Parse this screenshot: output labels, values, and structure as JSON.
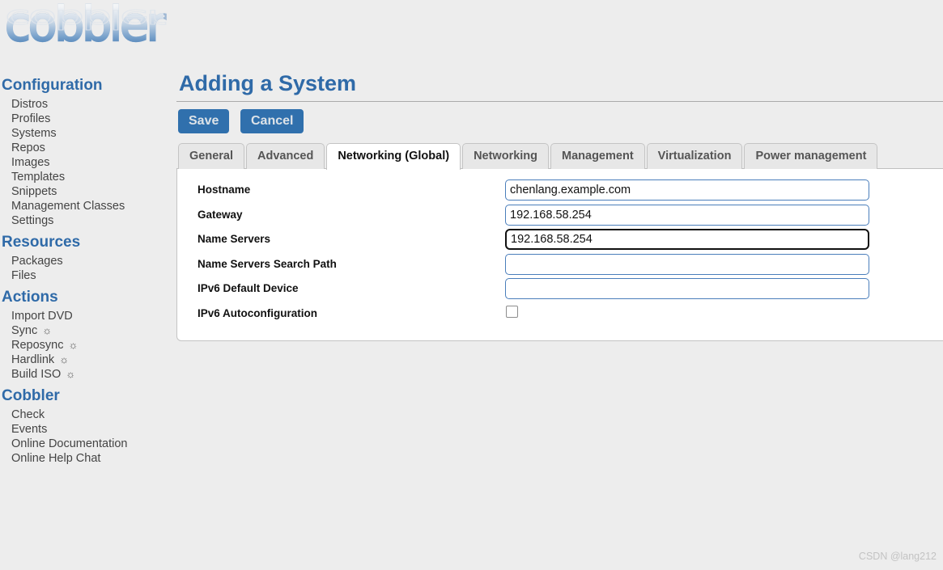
{
  "brand": {
    "logo_text": "cobbler"
  },
  "sidebar": {
    "groups": [
      {
        "heading": "Configuration",
        "items": [
          {
            "label": "Distros",
            "icon": ""
          },
          {
            "label": "Profiles",
            "icon": ""
          },
          {
            "label": "Systems",
            "icon": ""
          },
          {
            "label": "Repos",
            "icon": ""
          },
          {
            "label": "Images",
            "icon": ""
          },
          {
            "label": "Templates",
            "icon": ""
          },
          {
            "label": "Snippets",
            "icon": ""
          },
          {
            "label": "Management Classes",
            "icon": ""
          },
          {
            "label": "Settings",
            "icon": ""
          }
        ]
      },
      {
        "heading": "Resources",
        "items": [
          {
            "label": "Packages",
            "icon": ""
          },
          {
            "label": "Files",
            "icon": ""
          }
        ]
      },
      {
        "heading": "Actions",
        "items": [
          {
            "label": "Import DVD",
            "icon": ""
          },
          {
            "label": "Sync",
            "icon": "☼"
          },
          {
            "label": "Reposync",
            "icon": "☼"
          },
          {
            "label": "Hardlink",
            "icon": "☼"
          },
          {
            "label": "Build ISO",
            "icon": "☼"
          }
        ]
      },
      {
        "heading": "Cobbler",
        "items": [
          {
            "label": "Check",
            "icon": ""
          },
          {
            "label": "Events",
            "icon": ""
          },
          {
            "label": "Online Documentation",
            "icon": ""
          },
          {
            "label": "Online Help Chat",
            "icon": ""
          }
        ]
      }
    ]
  },
  "main": {
    "title": "Adding a System",
    "buttons": {
      "save": "Save",
      "cancel": "Cancel"
    },
    "tabs": [
      {
        "label": "General",
        "active": false
      },
      {
        "label": "Advanced",
        "active": false
      },
      {
        "label": "Networking (Global)",
        "active": true
      },
      {
        "label": "Networking",
        "active": false
      },
      {
        "label": "Management",
        "active": false
      },
      {
        "label": "Virtualization",
        "active": false
      },
      {
        "label": "Power management",
        "active": false
      }
    ],
    "form": {
      "fields": [
        {
          "label": "Hostname",
          "type": "text",
          "value": "chenlang.example.com",
          "placeholder": "",
          "focused": false
        },
        {
          "label": "Gateway",
          "type": "text",
          "value": "192.168.58.254",
          "placeholder": "",
          "focused": false
        },
        {
          "label": "Name Servers",
          "type": "text",
          "value": "192.168.58.254",
          "placeholder": "",
          "focused": true
        },
        {
          "label": "Name Servers Search Path",
          "type": "text",
          "value": "",
          "placeholder": "",
          "focused": false
        },
        {
          "label": "IPv6 Default Device",
          "type": "text",
          "value": "",
          "placeholder": "",
          "focused": false
        },
        {
          "label": "IPv6 Autoconfiguration",
          "type": "checkbox",
          "checked": false,
          "focused": false
        }
      ]
    }
  },
  "watermark": {
    "text": "CSDN @lang212"
  },
  "colors": {
    "accent_blue": "#2f6aa8",
    "button_blue": "#3070ad",
    "input_border": "#4a7ebb",
    "page_background": "#ededed",
    "focus_border": "#111111"
  }
}
